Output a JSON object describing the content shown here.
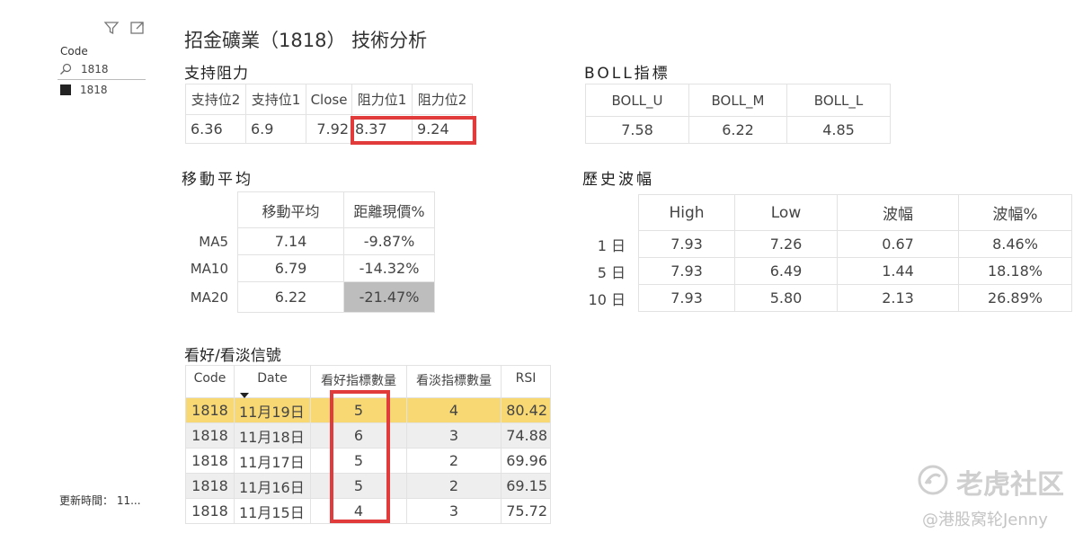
{
  "filter_panel": {
    "code_label": "Code",
    "search_value": "1818",
    "item_label": "1818",
    "update_label": "更新時間： 11..."
  },
  "page_title": "招金礦業（1818） 技術分析",
  "support_resistance": {
    "title": "支持阻力",
    "headers": [
      "支持位2",
      "支持位1",
      "Close",
      "阻力位1",
      "阻力位2"
    ],
    "values": [
      "6.36",
      "6.9",
      "7.92",
      "8.37",
      "9.24"
    ]
  },
  "boll": {
    "title": "BOLL指標",
    "headers": [
      "BOLL_U",
      "BOLL_M",
      "BOLL_L"
    ],
    "values": [
      "7.58",
      "6.22",
      "4.85"
    ]
  },
  "moving_average": {
    "title": "移動平均",
    "headers": [
      "移動平均",
      "距離現價%"
    ],
    "rows": [
      {
        "label": "MA5",
        "ma": "7.14",
        "dist": "-9.87%"
      },
      {
        "label": "MA10",
        "ma": "6.79",
        "dist": "-14.32%"
      },
      {
        "label": "MA20",
        "ma": "6.22",
        "dist": "-21.47%"
      }
    ],
    "highlight_color": "#bdbdbd"
  },
  "volatility": {
    "title": "歷史波幅",
    "headers": [
      "High",
      "Low",
      "波幅",
      "波幅%"
    ],
    "rows": [
      {
        "label": "1 日",
        "high": "7.93",
        "low": "7.26",
        "range": "0.67",
        "pct": "8.46%"
      },
      {
        "label": "5 日",
        "high": "7.93",
        "low": "6.49",
        "range": "1.44",
        "pct": "18.18%"
      },
      {
        "label": "10 日",
        "high": "7.93",
        "low": "5.80",
        "range": "2.13",
        "pct": "26.89%"
      }
    ]
  },
  "signals": {
    "title": "看好/看淡信號",
    "headers": [
      "Code",
      "Date",
      "看好指標數量",
      "看淡指標數量",
      "RSI"
    ],
    "rows": [
      {
        "code": "1818",
        "date": "11月19日",
        "bull": "5",
        "bear": "4",
        "rsi": "80.42"
      },
      {
        "code": "1818",
        "date": "11月18日",
        "bull": "6",
        "bear": "3",
        "rsi": "74.88"
      },
      {
        "code": "1818",
        "date": "11月17日",
        "bull": "5",
        "bear": "2",
        "rsi": "69.96"
      },
      {
        "code": "1818",
        "date": "11月16日",
        "bull": "5",
        "bear": "2",
        "rsi": "69.15"
      },
      {
        "code": "1818",
        "date": "11月15日",
        "bull": "4",
        "bear": "3",
        "rsi": "75.72"
      }
    ],
    "highlight_color": "#f7d873",
    "stripe_color": "#eeeeee"
  },
  "watermark": {
    "brand": "老虎社区",
    "author": "@港股窝轮Jenny"
  },
  "colors": {
    "red_box": "#e23b3b"
  }
}
